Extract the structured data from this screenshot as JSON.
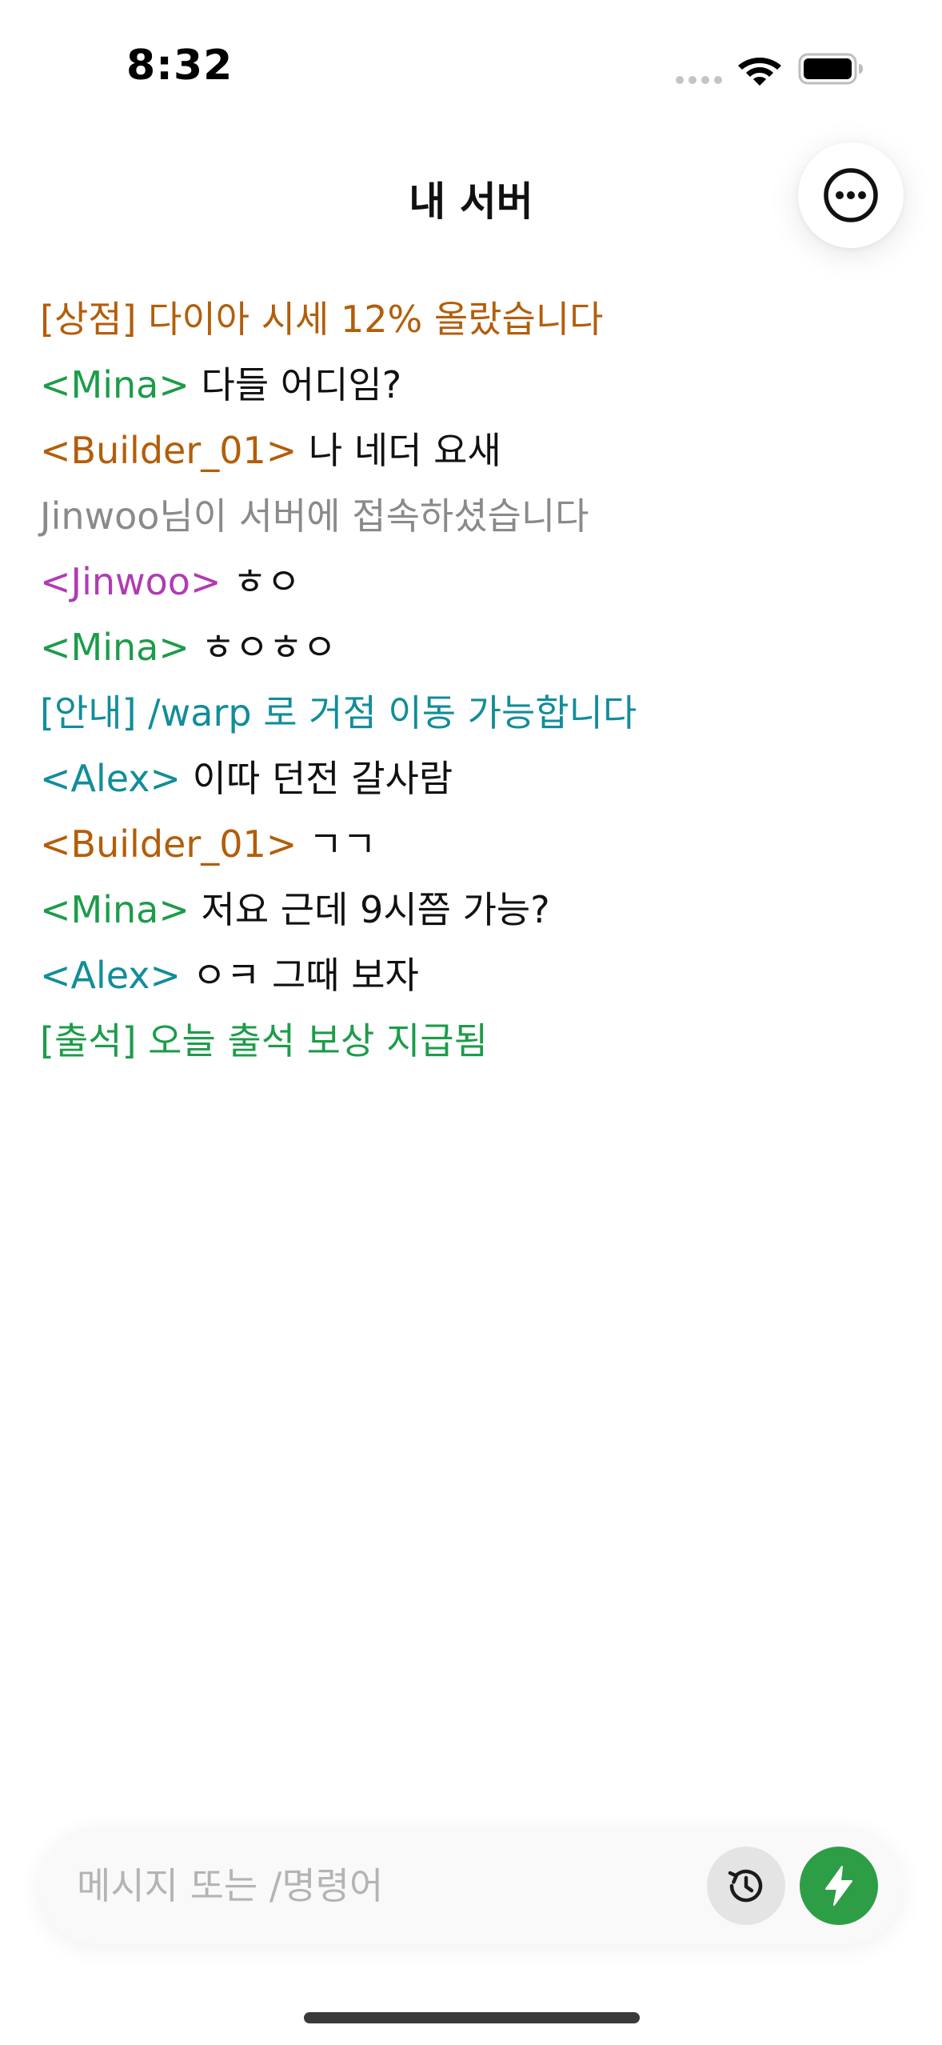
{
  "status_bar": {
    "time": "8:32"
  },
  "header": {
    "title": "내 서버",
    "menu_icon": "ellipsis-circle-icon"
  },
  "chat": {
    "lines": [
      {
        "type": "system",
        "text": "[상점] 다이아 시세 12% 올랐습니다",
        "color": "#b35e0a"
      },
      {
        "type": "player",
        "tag": "<Mina>",
        "tag_color": "#1d9c4a",
        "text": " 다들 어디임?"
      },
      {
        "type": "player",
        "tag": "<Builder_01>",
        "tag_color": "#b35e0a",
        "text": " 나 네더 요새"
      },
      {
        "type": "system",
        "text": "Jinwoo님이 서버에 접속하셨습니다",
        "color": "#8a8a8a"
      },
      {
        "type": "player",
        "tag": "<Jinwoo>",
        "tag_color": "#b13bb3",
        "text": " ㅎㅇ"
      },
      {
        "type": "player",
        "tag": "<Mina>",
        "tag_color": "#1d9c4a",
        "text": " ㅎㅇㅎㅇ"
      },
      {
        "type": "system",
        "text": "[안내] /warp 로 거점 이동 가능합니다",
        "color": "#128d9a"
      },
      {
        "type": "player",
        "tag": "<Alex>",
        "tag_color": "#128d9a",
        "text": " 이따 던전 갈사람"
      },
      {
        "type": "player",
        "tag": "<Builder_01>",
        "tag_color": "#b35e0a",
        "text": " ㄱㄱ"
      },
      {
        "type": "player",
        "tag": "<Mina>",
        "tag_color": "#1d9c4a",
        "text": " 저요 근데 9시쯤 가능?"
      },
      {
        "type": "player",
        "tag": "<Alex>",
        "tag_color": "#128d9a",
        "text": " ㅇㅋ 그때 보자"
      },
      {
        "type": "system",
        "text": "[출석] 오늘 출석 보상 지급됨",
        "color": "#1d9c4a"
      }
    ]
  },
  "composer": {
    "placeholder": "메시지 또는 /명령어",
    "value": "",
    "history_icon": "history-clock-icon",
    "action_icon": "lightning-bolt-icon",
    "action_color": "#2e9e46"
  }
}
